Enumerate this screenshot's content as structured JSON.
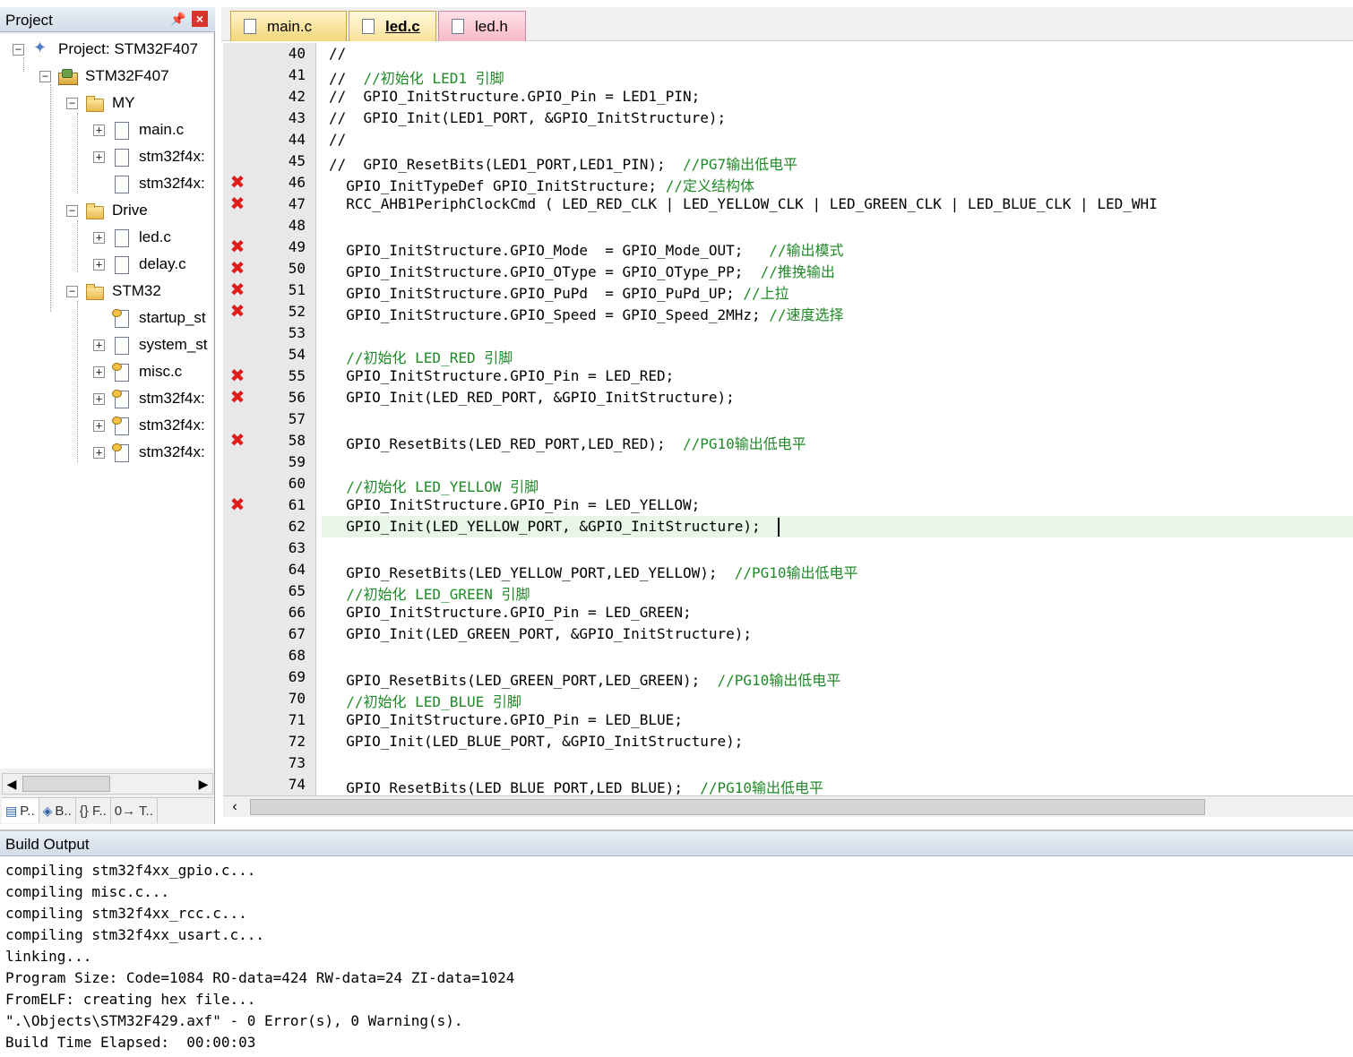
{
  "project": {
    "title": "Project",
    "pin_icon": "pin-icon",
    "close_icon": "close-icon",
    "tree": [
      {
        "label": "Project: STM32F407",
        "icon": "project-icon",
        "toggle": "−",
        "indent": 0
      },
      {
        "label": "STM32F407",
        "icon": "target-icon",
        "toggle": "−",
        "indent": 1
      },
      {
        "label": "MY",
        "icon": "folder-icon",
        "toggle": "−",
        "indent": 2
      },
      {
        "label": "main.c",
        "icon": "file-icon",
        "toggle": "+",
        "indent": 3
      },
      {
        "label": "stm32f4x:",
        "icon": "file-icon",
        "toggle": "+",
        "indent": 3
      },
      {
        "label": "stm32f4x:",
        "icon": "file-icon",
        "toggle": "",
        "indent": 3
      },
      {
        "label": "Drive",
        "icon": "folder-icon",
        "toggle": "−",
        "indent": 2
      },
      {
        "label": "led.c",
        "icon": "file-icon",
        "toggle": "+",
        "indent": 3
      },
      {
        "label": "delay.c",
        "icon": "file-icon",
        "toggle": "+",
        "indent": 3
      },
      {
        "label": "STM32",
        "icon": "folder-icon",
        "toggle": "−",
        "indent": 2
      },
      {
        "label": "startup_st",
        "icon": "config-file-icon",
        "toggle": "",
        "indent": 3
      },
      {
        "label": "system_st",
        "icon": "file-icon",
        "toggle": "+",
        "indent": 3
      },
      {
        "label": "misc.c",
        "icon": "config-file-icon",
        "toggle": "+",
        "indent": 3
      },
      {
        "label": "stm32f4x:",
        "icon": "config-file-icon",
        "toggle": "+",
        "indent": 3
      },
      {
        "label": "stm32f4x:",
        "icon": "config-file-icon",
        "toggle": "+",
        "indent": 3
      },
      {
        "label": "stm32f4x:",
        "icon": "config-file-icon",
        "toggle": "+",
        "indent": 3
      }
    ],
    "bottom_tabs": [
      {
        "label": "P..",
        "icon": "project-tab-icon"
      },
      {
        "label": "B..",
        "icon": "books-tab-icon"
      },
      {
        "label": "{} F..",
        "icon": "functions-tab-icon"
      },
      {
        "label": "0→ T..",
        "icon": "templates-tab-icon"
      }
    ]
  },
  "editor": {
    "tabs": [
      {
        "label": "main.c",
        "active": false
      },
      {
        "label": "led.c",
        "active": true
      },
      {
        "label": "led.h",
        "active": false
      }
    ],
    "current_line": "62",
    "lines": [
      {
        "n": "40",
        "bp": false,
        "code": "//",
        "comment": ""
      },
      {
        "n": "41",
        "bp": false,
        "code": "//  ",
        "comment": "//初始化 LED1 引脚"
      },
      {
        "n": "42",
        "bp": false,
        "code": "//  GPIO_InitStructure.GPIO_Pin = LED1_PIN;",
        "comment": ""
      },
      {
        "n": "43",
        "bp": false,
        "code": "//  GPIO_Init(LED1_PORT, &GPIO_InitStructure);",
        "comment": ""
      },
      {
        "n": "44",
        "bp": false,
        "code": "//",
        "comment": ""
      },
      {
        "n": "45",
        "bp": false,
        "code": "//  GPIO_ResetBits(LED1_PORT,LED1_PIN);  ",
        "comment": "//PG7输出低电平"
      },
      {
        "n": "46",
        "bp": true,
        "code": "  GPIO_InitTypeDef GPIO_InitStructure; ",
        "comment": "//定义结构体"
      },
      {
        "n": "47",
        "bp": true,
        "code": "  RCC_AHB1PeriphClockCmd ( LED_RED_CLK | LED_YELLOW_CLK | LED_GREEN_CLK | LED_BLUE_CLK | LED_WHI",
        "comment": ""
      },
      {
        "n": "48",
        "bp": false,
        "code": "",
        "comment": ""
      },
      {
        "n": "49",
        "bp": true,
        "code": "  GPIO_InitStructure.GPIO_Mode  = GPIO_Mode_OUT;   ",
        "comment": "//输出模式"
      },
      {
        "n": "50",
        "bp": true,
        "code": "  GPIO_InitStructure.GPIO_OType = GPIO_OType_PP;  ",
        "comment": "//推挽输出"
      },
      {
        "n": "51",
        "bp": true,
        "code": "  GPIO_InitStructure.GPIO_PuPd  = GPIO_PuPd_UP; ",
        "comment": "//上拉"
      },
      {
        "n": "52",
        "bp": true,
        "code": "  GPIO_InitStructure.GPIO_Speed = GPIO_Speed_2MHz; ",
        "comment": "//速度选择"
      },
      {
        "n": "53",
        "bp": false,
        "code": "",
        "comment": ""
      },
      {
        "n": "54",
        "bp": false,
        "code": "  ",
        "comment": "//初始化 LED_RED 引脚"
      },
      {
        "n": "55",
        "bp": true,
        "code": "  GPIO_InitStructure.GPIO_Pin = LED_RED;",
        "comment": ""
      },
      {
        "n": "56",
        "bp": true,
        "code": "  GPIO_Init(LED_RED_PORT, &GPIO_InitStructure);",
        "comment": ""
      },
      {
        "n": "57",
        "bp": false,
        "code": "",
        "comment": ""
      },
      {
        "n": "58",
        "bp": true,
        "code": "  GPIO_ResetBits(LED_RED_PORT,LED_RED);  ",
        "comment": "//PG10输出低电平"
      },
      {
        "n": "59",
        "bp": false,
        "code": "",
        "comment": ""
      },
      {
        "n": "60",
        "bp": false,
        "code": "  ",
        "comment": "//初始化 LED_YELLOW 引脚"
      },
      {
        "n": "61",
        "bp": true,
        "code": "  GPIO_InitStructure.GPIO_Pin = LED_YELLOW;",
        "comment": ""
      },
      {
        "n": "62",
        "bp": false,
        "code": "  GPIO_Init(LED_YELLOW_PORT, &GPIO_InitStructure); ",
        "comment": ""
      },
      {
        "n": "63",
        "bp": false,
        "code": "",
        "comment": ""
      },
      {
        "n": "64",
        "bp": false,
        "code": "  GPIO_ResetBits(LED_YELLOW_PORT,LED_YELLOW);  ",
        "comment": "//PG10输出低电平"
      },
      {
        "n": "65",
        "bp": false,
        "code": "  ",
        "comment": "//初始化 LED_GREEN 引脚"
      },
      {
        "n": "66",
        "bp": false,
        "code": "  GPIO_InitStructure.GPIO_Pin = LED_GREEN;",
        "comment": ""
      },
      {
        "n": "67",
        "bp": false,
        "code": "  GPIO_Init(LED_GREEN_PORT, &GPIO_InitStructure);",
        "comment": ""
      },
      {
        "n": "68",
        "bp": false,
        "code": "",
        "comment": ""
      },
      {
        "n": "69",
        "bp": false,
        "code": "  GPIO_ResetBits(LED_GREEN_PORT,LED_GREEN);  ",
        "comment": "//PG10输出低电平"
      },
      {
        "n": "70",
        "bp": false,
        "code": "  ",
        "comment": "//初始化 LED_BLUE 引脚"
      },
      {
        "n": "71",
        "bp": false,
        "code": "  GPIO_InitStructure.GPIO_Pin = LED_BLUE;",
        "comment": ""
      },
      {
        "n": "72",
        "bp": false,
        "code": "  GPIO_Init(LED_BLUE_PORT, &GPIO_InitStructure);",
        "comment": ""
      },
      {
        "n": "73",
        "bp": false,
        "code": "",
        "comment": ""
      },
      {
        "n": "74",
        "bp": false,
        "code": "  GPIO_ResetBits(LED_BLUE_PORT,LED_BLUE);  ",
        "comment": "//PG10输出低电平"
      }
    ]
  },
  "build": {
    "title": "Build Output",
    "lines": [
      "compiling stm32f4xx_gpio.c...",
      "compiling misc.c...",
      "compiling stm32f4xx_rcc.c...",
      "compiling stm32f4xx_usart.c...",
      "linking...",
      "Program Size: Code=1084 RO-data=424 RW-data=24 ZI-data=1024",
      "FromELF: creating hex file...",
      "\".\\Objects\\STM32F429.axf\" - 0 Error(s), 0 Warning(s).",
      "Build Time Elapsed:  00:00:03"
    ]
  },
  "colors": {
    "comment": "#1f8a27",
    "breakpoint": "#e21b1b",
    "current_line_bg": "#e8f6e8"
  }
}
